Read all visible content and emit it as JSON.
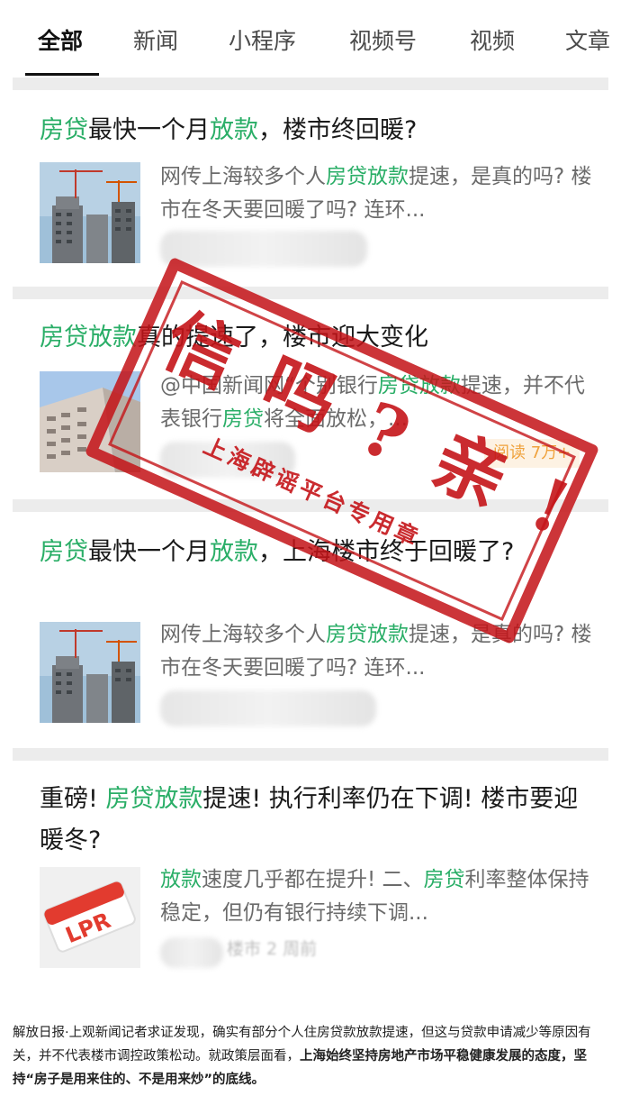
{
  "tabs": [
    "全部",
    "新闻",
    "小程序",
    "视频号",
    "视频",
    "文章"
  ],
  "articles": [
    {
      "title_parts": [
        {
          "text": "房贷",
          "hl": true
        },
        {
          "text": "最快一个月",
          "hl": false
        },
        {
          "text": "放款",
          "hl": true
        },
        {
          "text": "，楼市终回暖?",
          "hl": false
        }
      ],
      "snippet_parts": [
        {
          "text": "网传上海较多个人",
          "hl": false
        },
        {
          "text": "房贷放款",
          "hl": true
        },
        {
          "text": "提速，是真的吗? 楼市在冬天要回暖了吗? 连环...",
          "hl": false
        }
      ],
      "thumb_icon": "building-photo-icon"
    },
    {
      "title_parts": [
        {
          "text": "房贷放款",
          "hl": true
        },
        {
          "text": "真的提速了，楼市迎大变化",
          "hl": false
        }
      ],
      "snippet_parts": [
        {
          "text": "@中国新闻网“个别银行",
          "hl": false
        },
        {
          "text": "房贷放款",
          "hl": true
        },
        {
          "text": "提速，并不代表银行",
          "hl": false
        },
        {
          "text": "房贷",
          "hl": true
        },
        {
          "text": "将全面放松，...",
          "hl": false
        }
      ],
      "read_badge": "阅读 7万+",
      "thumb_icon": "apartment-photo-icon"
    },
    {
      "title_parts": [
        {
          "text": "房贷",
          "hl": true
        },
        {
          "text": "最快一个月",
          "hl": false
        },
        {
          "text": "放款",
          "hl": true
        },
        {
          "text": "，上海楼市终于回暖了?",
          "hl": false
        }
      ],
      "snippet_parts": [
        {
          "text": "网传上海较多个人",
          "hl": false
        },
        {
          "text": "房贷放款",
          "hl": true
        },
        {
          "text": "提速，是真的吗? 楼市在冬天要回暖了吗? 连环...",
          "hl": false
        }
      ],
      "thumb_icon": "building-photo-icon"
    },
    {
      "title_parts": [
        {
          "text": "重磅! ",
          "hl": false
        },
        {
          "text": "房贷放款",
          "hl": true
        },
        {
          "text": "提速! 执行利率仍在下调! 楼市要迎暖冬?",
          "hl": false
        }
      ],
      "snippet_parts": [
        {
          "text": "放款",
          "hl": true
        },
        {
          "text": "速度几乎都在提升! 二、",
          "hl": false
        },
        {
          "text": "房贷",
          "hl": true
        },
        {
          "text": "利率整体保持稳定，但仍有银行持续下调...",
          "hl": false
        }
      ],
      "meta_blurred": "楼市 2 周前",
      "thumb_label": "LPR",
      "thumb_icon": "lpr-card-icon"
    }
  ],
  "stamp": {
    "main": "信吗?亲!",
    "sub": "上海辟谣平台专用章"
  },
  "caption": {
    "normal": "解放日报·上观新闻记者求证发现，确实有部分个人住房贷款放款提速，但这与贷款申请减少等原因有关，并不代表楼市调控政策松动。就政策层面看，",
    "bold": "上海始终坚持房地产市场平稳健康发展的态度，坚持“房子是用来住的、不是用来炒”的底线。"
  },
  "colors": {
    "highlight": "#2aae67",
    "stamp_red": "#c41418",
    "badge_text": "#f0a23c"
  }
}
